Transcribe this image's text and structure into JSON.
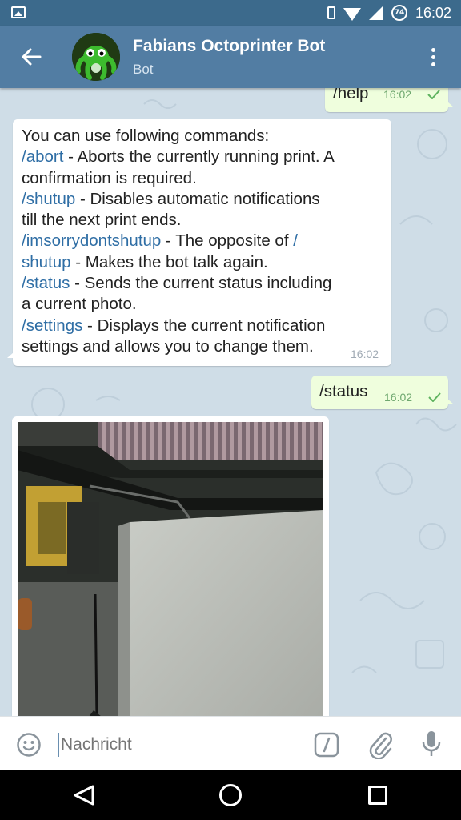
{
  "status_bar": {
    "time": "16:02",
    "battery": "74"
  },
  "header": {
    "title": "Fabians Octoprinter Bot",
    "subtitle": "Bot"
  },
  "messages": [
    {
      "id": "m1",
      "side": "out",
      "text": "/help",
      "time": "16:02"
    },
    {
      "id": "m2",
      "side": "in",
      "time": "16:02",
      "lines": [
        {
          "plain": "You can use following commands:"
        },
        {
          "cmd": "/abort",
          "plain": " - Aborts the currently running print. A"
        },
        {
          "plain": "confirmation is required."
        },
        {
          "cmd": "/shutup",
          "plain": " - Disables automatic notifications"
        },
        {
          "plain": "till the next print ends."
        },
        {
          "cmd": "/imsorrydontshutup",
          "plain": " - The opposite of ",
          "cmd_after": "/"
        },
        {
          "cmd": "shutup",
          "plain": " - Makes the bot talk again."
        },
        {
          "cmd": "/status",
          "plain": " - Sends the current status including"
        },
        {
          "plain": "a current photo."
        },
        {
          "cmd": "/settings",
          "plain": " - Displays the current notification"
        },
        {
          "plain": "settings and allows you to change them."
        }
      ]
    },
    {
      "id": "m3",
      "side": "out",
      "text": "/status",
      "time": "16:02"
    }
  ],
  "input": {
    "placeholder": "Nachricht"
  },
  "colors": {
    "header": "#527da3",
    "status_bar": "#3c6a8c",
    "command_link": "#2f6ea5",
    "outgoing_bubble": "#effedd"
  }
}
